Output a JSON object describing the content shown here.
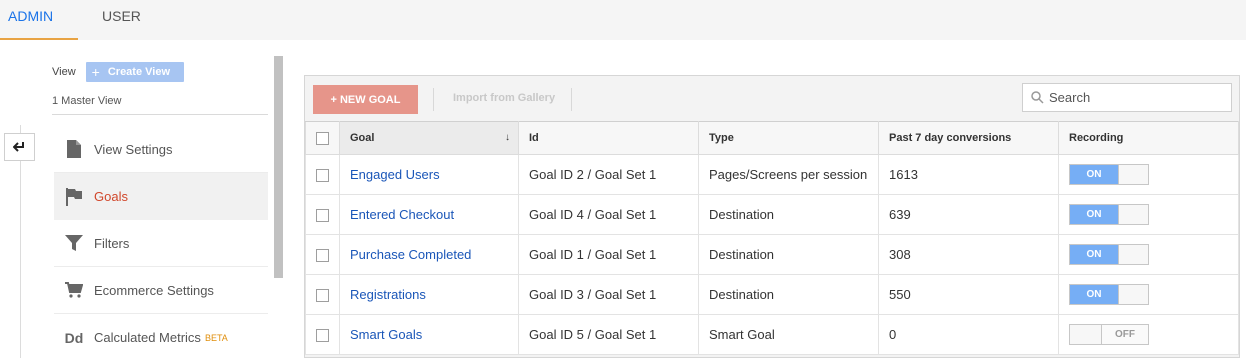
{
  "tabs": [
    {
      "label": "ADMIN",
      "active": true
    },
    {
      "label": "USER",
      "active": false
    }
  ],
  "sidebar": {
    "view_label": "View",
    "create_view_label": "Create View",
    "master_view": "1 Master View",
    "items": [
      {
        "label": "View Settings",
        "icon": "document-icon",
        "active": false
      },
      {
        "label": "Goals",
        "icon": "flag-icon",
        "active": true
      },
      {
        "label": "Filters",
        "icon": "filter-icon",
        "active": false
      },
      {
        "label": "Ecommerce Settings",
        "icon": "cart-icon",
        "active": false
      },
      {
        "label": "Calculated Metrics",
        "icon": "dd-icon",
        "active": false,
        "badge": "BETA"
      }
    ]
  },
  "toolbar": {
    "new_goal_label": "+ NEW GOAL",
    "import_label": "Import from Gallery",
    "search_placeholder": "Search"
  },
  "table": {
    "columns": [
      "Goal",
      "Id",
      "Type",
      "Past 7 day conversions",
      "Recording"
    ],
    "rows": [
      {
        "goal": "Engaged Users",
        "id": "Goal ID 2 / Goal Set 1",
        "type": "Pages/Screens per session",
        "conversions": "1613",
        "recording": "ON"
      },
      {
        "goal": "Entered Checkout",
        "id": "Goal ID 4 / Goal Set 1",
        "type": "Destination",
        "conversions": "639",
        "recording": "ON"
      },
      {
        "goal": "Purchase Completed",
        "id": "Goal ID 1 / Goal Set 1",
        "type": "Destination",
        "conversions": "308",
        "recording": "ON"
      },
      {
        "goal": "Registrations",
        "id": "Goal ID 3 / Goal Set 1",
        "type": "Destination",
        "conversions": "550",
        "recording": "ON"
      },
      {
        "goal": "Smart Goals",
        "id": "Goal ID 5 / Goal Set 1",
        "type": "Smart Goal",
        "conversions": "0",
        "recording": "OFF"
      }
    ]
  },
  "colors": {
    "accent": "#1a73e8",
    "active_nav": "#d1472b",
    "new_goal_button": "#e6958a",
    "toggle_on": "#76aef5"
  }
}
